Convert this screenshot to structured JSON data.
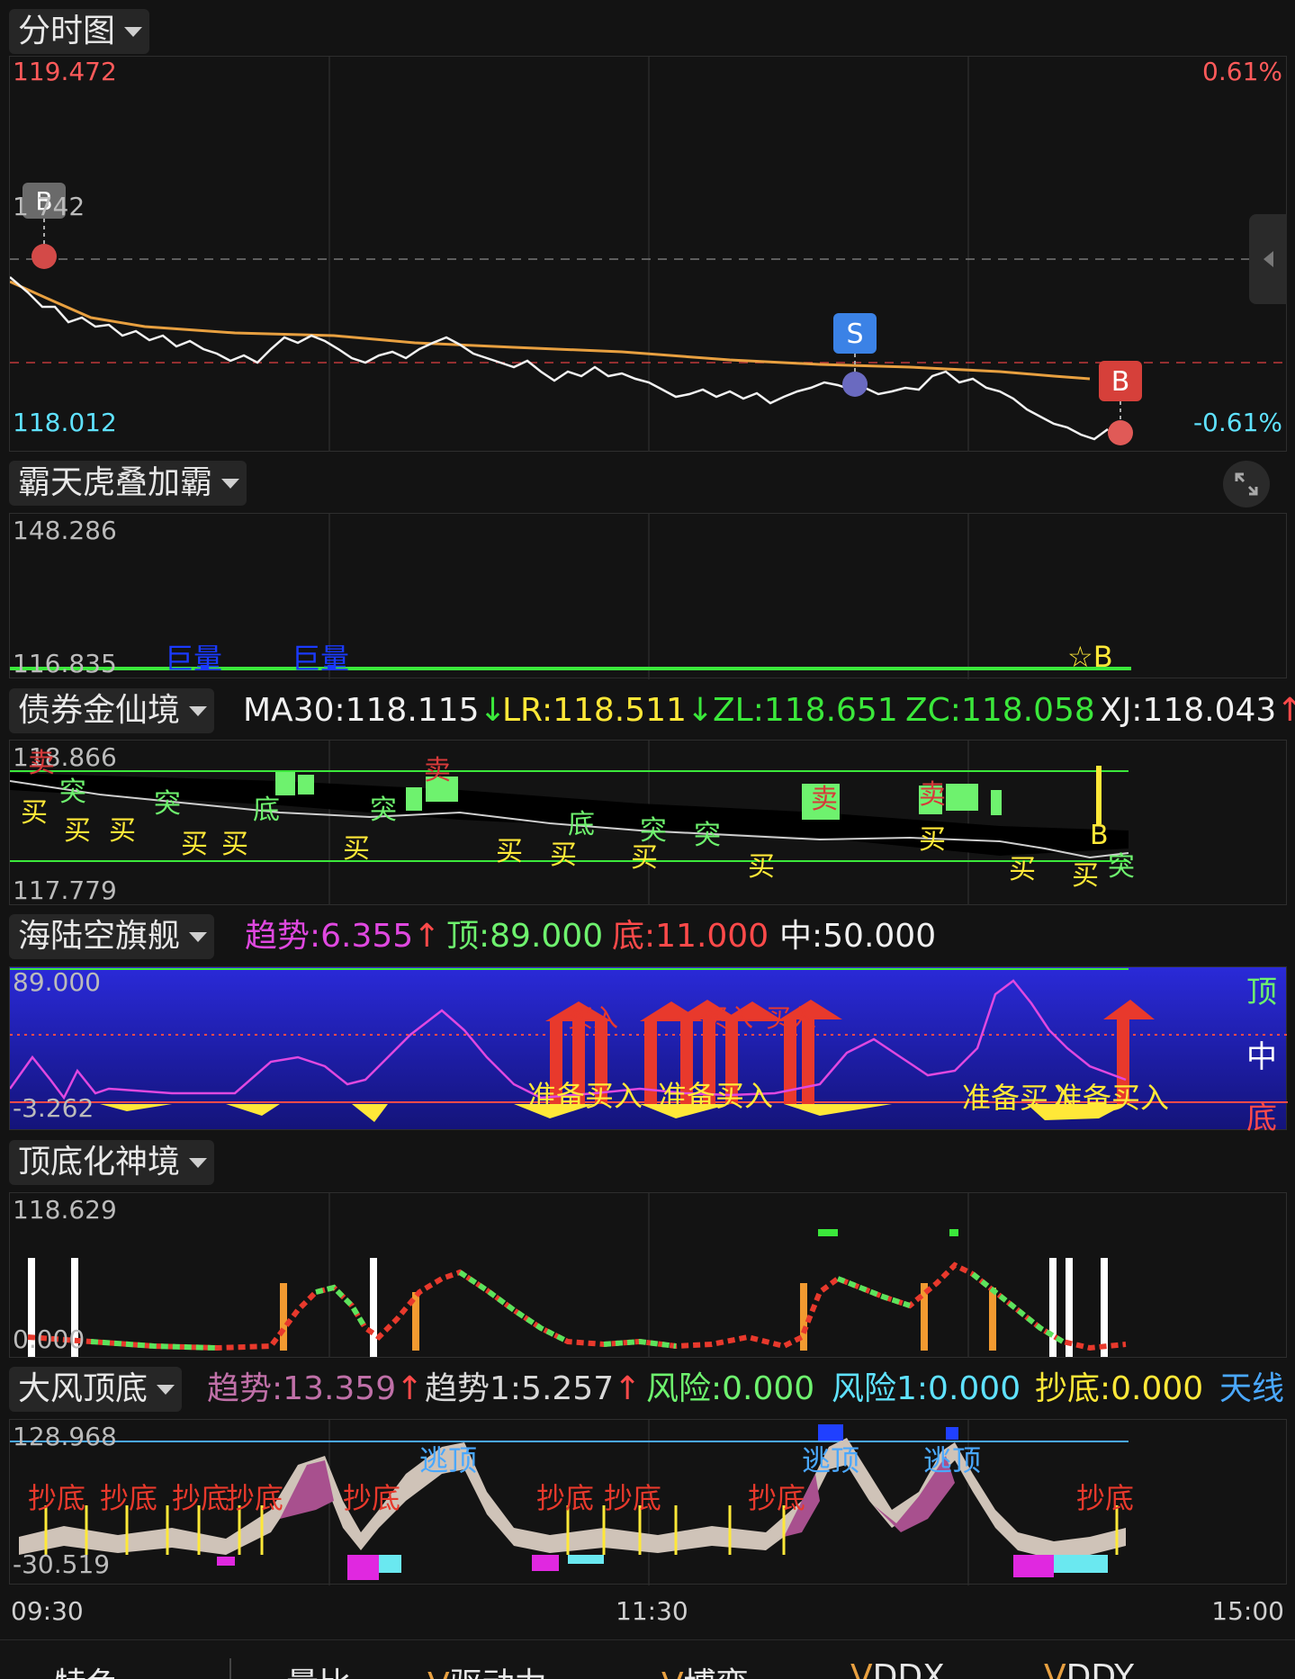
{
  "panel1": {
    "title": "分时图",
    "y_high": "119.472",
    "y_mid": "1 742",
    "y_low": "118.012",
    "pct_high": "0.61%",
    "pct_low": "-0.61%",
    "marker_b1": "B",
    "marker_s": "S",
    "marker_b2": "B",
    "colors": {
      "price": "#ffffff",
      "avg": "#e8a040",
      "up": "#ff4a4a",
      "down": "#4fe0ff"
    }
  },
  "panel2": {
    "title": "霸天虎叠加霸",
    "y_high": "148.286",
    "y_low": "116.835",
    "tag1": "巨量",
    "tag2": "巨量",
    "tag3": "☆B"
  },
  "panel3": {
    "title": "债券金仙境",
    "ma30_label": "MA30:",
    "ma30_value": "118.115",
    "lr_label": "LR:",
    "lr_value": "118.511",
    "zl_label": "ZL:",
    "zl_value": "118.651",
    "zc_label": "ZC:",
    "zc_value": "118.058",
    "xj_label": "XJ:",
    "xj_value": "118.043",
    "y_high": "118.866",
    "y_low": "117.779",
    "txt_sell": "卖",
    "txt_break": "突",
    "txt_buy": "买",
    "txt_bottom": "底",
    "txt_b": "B"
  },
  "panel4": {
    "title": "海陆空旗舰",
    "trend_label": "趋势:",
    "trend_value": "6.355",
    "top_label": "顶:",
    "top_value": "89.000",
    "bottom_label": "底:",
    "bottom_value": "11.000",
    "mid_label": "中:",
    "mid_value": "50.000",
    "y_high": "89.000",
    "y_low": "-3.262",
    "right_top": "顶",
    "right_mid": "中",
    "right_bottom": "底",
    "buy_text": "买入",
    "prepare_text": "准备买入"
  },
  "panel5": {
    "title": "顶底化神境",
    "y_high": "118.629",
    "y_low": "0.000"
  },
  "panel6": {
    "title": "大风顶底",
    "trend_label": "趋势:",
    "trend_value": "13.359",
    "trend1_label": "趋势1:",
    "trend1_value": "5.257",
    "risk_label": "风险:",
    "risk_value": "0.000",
    "risk1_label": "风险1:",
    "risk1_value": "0.000",
    "chaodi_label": "抄底:",
    "chaodi_value": "0.000",
    "tianxian_label": "天线",
    "y_high": "128.968",
    "y_low": "-30.519",
    "txt_chaodi": "抄底",
    "txt_taoding": "逃顶"
  },
  "time_axis": {
    "start": "09:30",
    "mid": "11:30",
    "end": "15:00"
  },
  "bottom_tabs": [
    "特色",
    "量比",
    "驱动力",
    "博弈",
    "DDX",
    "DDY"
  ]
}
